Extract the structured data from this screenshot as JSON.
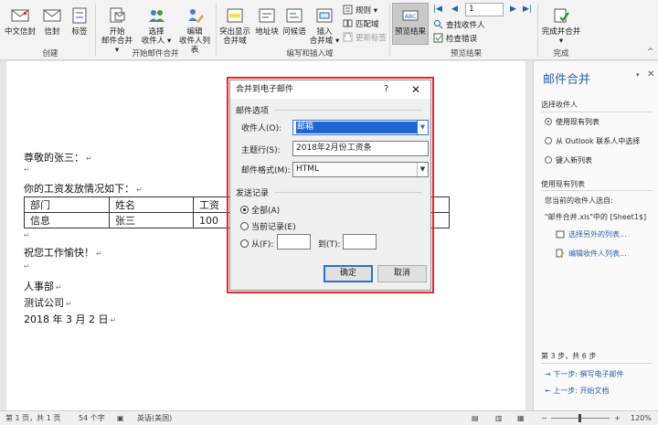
{
  "ribbon": {
    "buttons": {
      "chinese_envelope": "中文信封",
      "envelope": "信封",
      "labels": "标签",
      "start_merge_1": "开始",
      "start_merge_2": "邮件合并 ▾",
      "select_recipients_1": "选择",
      "select_recipients_2": "收件人 ▾",
      "edit_recipients_1": "编辑",
      "edit_recipients_2": "收件人列表",
      "highlight_fields_1": "突出显示",
      "highlight_fields_2": "合并域",
      "address_block": "地址块",
      "greeting_line": "问候语",
      "insert_field_1": "插入",
      "insert_field_2": "合并域 ▾",
      "rules": "规则 ▾",
      "match_fields": "匹配域",
      "update_labels": "更新标签",
      "preview_results": "预览结果",
      "record_number": "1",
      "find_recipient": "查找收件人",
      "check_errors": "检查错误",
      "finish_merge_1": "完成并合并",
      "finish_merge_2": "▾"
    },
    "groups": {
      "create": "创建",
      "start_merge": "开始邮件合并",
      "write_insert": "编写和插入域",
      "preview": "预览结果",
      "finish": "完成"
    }
  },
  "document": {
    "greeting": "尊敬的张三：",
    "intro": "你的工资发放情况如下：",
    "table": {
      "headers": [
        "部门",
        "姓名",
        "工资"
      ],
      "row": [
        "信息",
        "张三",
        "100"
      ]
    },
    "wish": "祝您工作愉快！",
    "sign_dept": "人事部",
    "sign_company": "测试公司",
    "date": "2018 年 3 月 2 日"
  },
  "dialog": {
    "title": "合并到电子邮件",
    "help": "?",
    "close": "✕",
    "section_options": "邮件选项",
    "recipient_label": "收件人(O):",
    "recipient_value": "邮箱",
    "subject_label": "主题行(S):",
    "subject_value": "2018年2月份工资条",
    "format_label": "邮件格式(M):",
    "format_value": "HTML",
    "section_send": "发送记录",
    "radio_all": "全部(A)",
    "radio_current": "当前记录(E)",
    "radio_from": "从(F):",
    "radio_to": "到(T):",
    "ok": "确定",
    "cancel": "取消"
  },
  "pane": {
    "title": "邮件合并",
    "close": "✕",
    "dropdown": "▾",
    "select_recipients": "选择收件人",
    "opt_existing": "使用现有列表",
    "opt_outlook": "从 Outlook 联系人中选择",
    "opt_new": "键入新列表",
    "use_existing": "使用现有列表",
    "current_from": "您当前的收件人选自:",
    "source": "\"邮件合并.xls\"中的 [Sheet1$]",
    "select_other": "选择另外的列表...",
    "edit_list": "编辑收件人列表...",
    "step": "第 3 步，共 6 步",
    "next": "下一步: 撰写电子邮件",
    "prev": "上一步: 开始文档"
  },
  "status": {
    "page": "第 1 页，共 1 页",
    "words": "54 个字",
    "language": "英语(美国)",
    "zoom": "120%"
  },
  "colors": {
    "accent": "#2b5fa8",
    "highlight_border": "#e32727",
    "selection": "#1e66d4"
  }
}
